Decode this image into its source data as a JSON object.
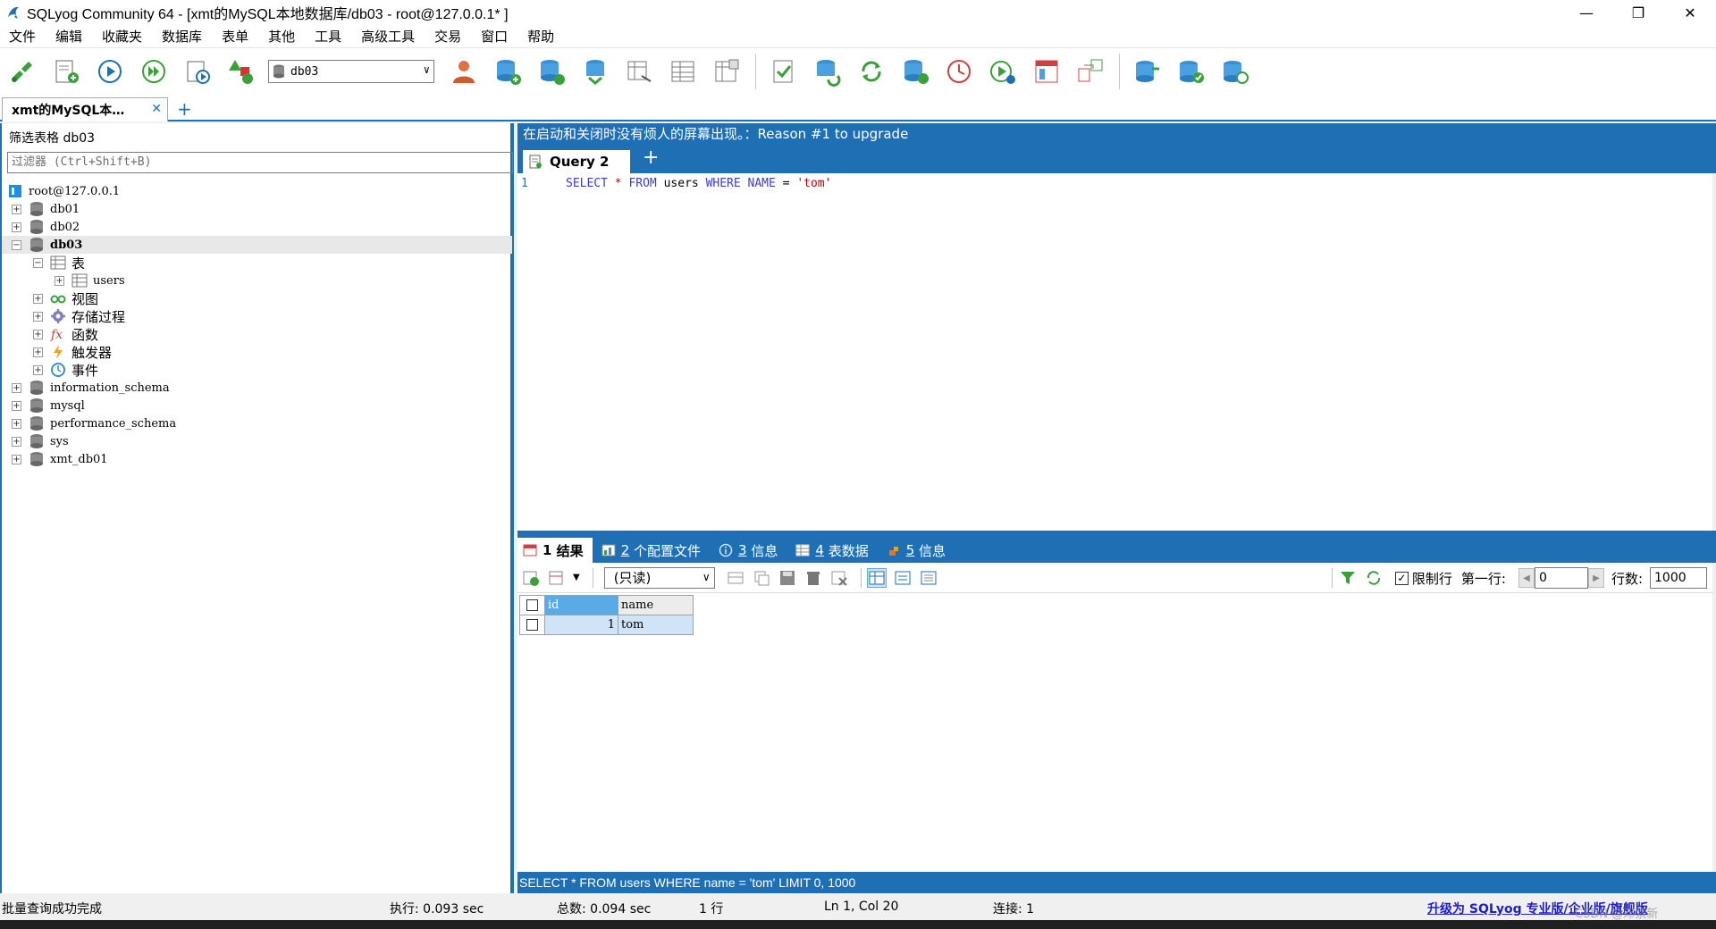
{
  "window": {
    "title": "SQLyog Community 64 - [xmt的MySQL本地数据库/db03 - root@127.0.0.1* ]",
    "minimize": "—",
    "maximize": "❐",
    "close": "✕"
  },
  "menu": [
    "文件",
    "编辑",
    "收藏夹",
    "数据库",
    "表单",
    "其他",
    "工具",
    "高级工具",
    "交易",
    "窗口",
    "帮助"
  ],
  "toolbar": {
    "db_selected": "db03"
  },
  "connection_tab": {
    "label": "xmt的MySQL本…",
    "close": "✕",
    "add": "+"
  },
  "left": {
    "filter_label": "筛选表格  db03",
    "filter_placeholder": "过滤器 (Ctrl+Shift+B)",
    "root": "root@127.0.0.1",
    "databases": {
      "db01": "db01",
      "db02": "db02",
      "db03": "db03",
      "information_schema": "information_schema",
      "mysql": "mysql",
      "performance_schema": "performance_schema",
      "sys": "sys",
      "xmt_db01": "xmt_db01"
    },
    "db03_children": {
      "tables": "表",
      "users": "users",
      "views": "视图",
      "procedures": "存储过程",
      "functions": "函数",
      "triggers": "触发器",
      "events": "事件"
    }
  },
  "editor": {
    "upgrade_banner": "在启动和关闭时没有烦人的屏幕出现。：Reason #1 to upgrade",
    "query_tab": "Query 2",
    "add_tab": "+",
    "line_number": "1",
    "sql": {
      "select": "SELECT",
      "star": "*",
      "from": "FROM",
      "table": "users",
      "where": "WHERE",
      "col": "NAME",
      "eq": "=",
      "value": "'tom'"
    }
  },
  "results": {
    "tabs": [
      {
        "num": "1",
        "label": "结果"
      },
      {
        "num": "2",
        "label": "个配置文件"
      },
      {
        "num": "3",
        "label": "信息"
      },
      {
        "num": "4",
        "label": "表数据"
      },
      {
        "num": "5",
        "label": "信息"
      }
    ],
    "mode": "(只读)",
    "limit_label": "限制行",
    "first_row_label": "第一行:",
    "first_row_value": "0",
    "rows_label": "行数:",
    "rows_value": "1000",
    "columns": [
      "id",
      "name"
    ],
    "rows": [
      {
        "id": "1",
        "name": "tom"
      }
    ]
  },
  "sql_status": "SELECT * FROM users WHERE name = 'tom' LIMIT 0, 1000",
  "statusbar": {
    "message": "批量查询成功完成",
    "exec": "执行: 0.093 sec",
    "total": "总数: 0.094 sec",
    "rows": "1 行",
    "position": "Ln 1, Col 20",
    "connections": "连接: 1",
    "upgrade": "升级为 SQLyog 专业版/企业版/旗舰版",
    "watermark": "CSDN @邓紫新"
  },
  "colors": {
    "accent": "#1e6fb4",
    "grid_header": "#5aaae8",
    "row_selected": "#cfe5f7",
    "keyword": "#3b3bd6",
    "string": "#c00000"
  }
}
